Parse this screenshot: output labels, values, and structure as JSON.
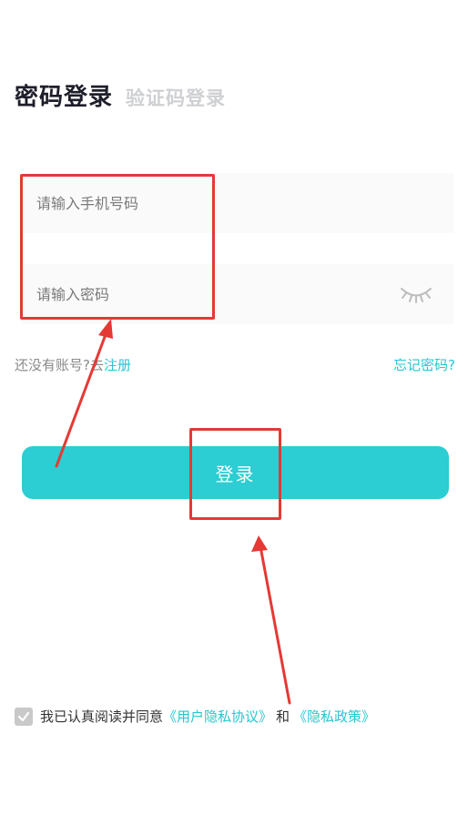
{
  "tabs": {
    "active": "密码登录",
    "inactive": "验证码登录"
  },
  "form": {
    "phone_placeholder": "请输入手机号码",
    "password_placeholder": "请输入密码",
    "eye_icon": "eye-closed-icon"
  },
  "links": {
    "no_account": "还没有账号?去",
    "register": "注册",
    "forgot": "忘记密码?"
  },
  "login_button": "登录",
  "agreement": {
    "prefix": "我已认真阅读并同意",
    "user_privacy": "《用户隐私协议》",
    "and": "和",
    "privacy_policy": "《隐私政策》"
  },
  "colors": {
    "accent": "#2ccdd3",
    "link": "#26c6d0",
    "annotation": "#e53935"
  }
}
